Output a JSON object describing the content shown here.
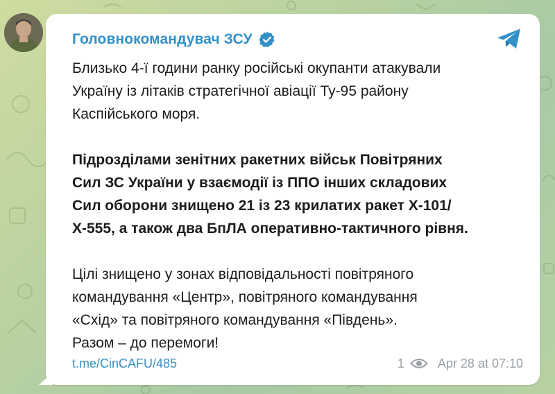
{
  "channel": {
    "name": "Головнокомандувач ЗСУ",
    "verified": true,
    "accent_color": "#3390c9"
  },
  "message": {
    "paragraph1": [
      "Близько 4-ї години ранку російські окупанти атакували",
      "Україну із літаків стратегічної авіації Ту-95 району",
      "Каспійського моря."
    ],
    "paragraph2": [
      "Підрозділами зенітних ракетних військ Повітряних",
      "Сил ЗС України у взаємодії із ППО інших складових",
      "Сил оборони знищено 21 із 23 крилатих ракет Х-101/",
      "Х-555, а також два БпЛА оперативно-тактичного рівня."
    ],
    "paragraph3": [
      "Цілі знищено у зонах відповідальності повітряного",
      "командування «Центр», повітряного командування",
      "«Схід» та повітряного командування «Південь».",
      "Разом – до перемоги!"
    ]
  },
  "footer": {
    "link": "t.me/CinCAFU/485",
    "views": "1",
    "date": "Apr 28 at 07:10"
  },
  "icons": {
    "share": "telegram-share-icon",
    "verified": "verified-badge-icon",
    "views": "eye-icon"
  }
}
